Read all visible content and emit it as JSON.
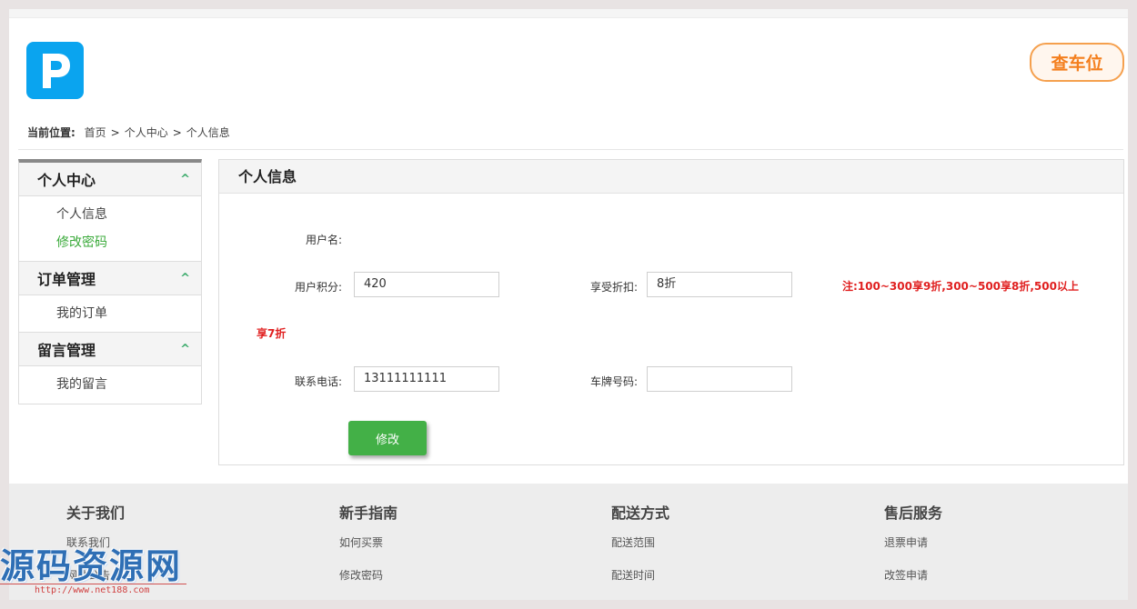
{
  "header": {
    "logo_letter": "P",
    "find_button": "查车位"
  },
  "breadcrumb": {
    "label": "当前位置:",
    "items": [
      "首页",
      "个人中心",
      "个人信息"
    ],
    "separator": ">"
  },
  "sidebar": {
    "sections": [
      {
        "title": "个人中心",
        "items": [
          "个人信息",
          "修改密码"
        ]
      },
      {
        "title": "订单管理",
        "items": [
          "我的订单"
        ]
      },
      {
        "title": "留言管理",
        "items": [
          "我的留言"
        ]
      }
    ]
  },
  "panel": {
    "title": "个人信息",
    "fields": {
      "username_label": "用户名:",
      "username_value": "",
      "points_label": "用户积分:",
      "points_value": "420",
      "discount_label": "享受折扣:",
      "discount_value": "8折",
      "phone_label": "联系电话:",
      "phone_value": "13111111111",
      "plate_label": "车牌号码:",
      "plate_value": ""
    },
    "note_line1": "注:100~300享9折,300~500享8折,500以上",
    "note_line2": "享7折",
    "submit_label": "修改"
  },
  "footer": {
    "columns": [
      {
        "title": "关于我们",
        "links": [
          "联系我们",
          "网站公告"
        ]
      },
      {
        "title": "新手指南",
        "links": [
          "如何买票",
          "修改密码"
        ]
      },
      {
        "title": "配送方式",
        "links": [
          "配送范围",
          "配送时间"
        ]
      },
      {
        "title": "售后服务",
        "links": [
          "退票申请",
          "改签申请"
        ]
      }
    ]
  },
  "watermark": {
    "text": "源码资源网",
    "url": "http://www.net188.com"
  },
  "colors": {
    "logo_bg": "#0aa4ef",
    "find_border": "#f5a04e",
    "submit_bg": "#43b047",
    "note_red": "#e02020",
    "active_green": "#3aaa3a"
  }
}
